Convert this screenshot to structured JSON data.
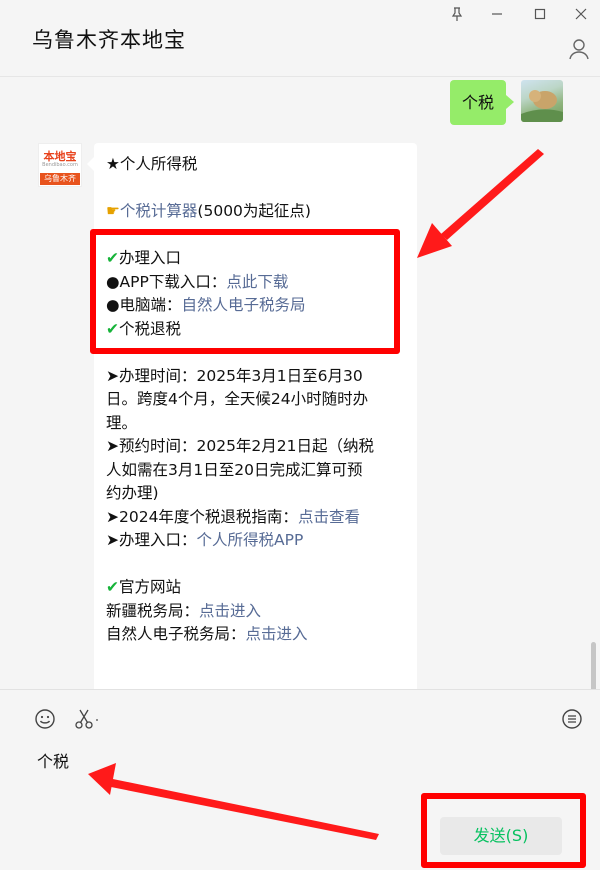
{
  "window": {
    "title": "乌鲁木齐本地宝",
    "pin_icon": "pin-icon",
    "minimize_icon": "minimize-icon",
    "maximize_icon": "maximize-icon",
    "close_icon": "close-icon",
    "profile_icon": "profile-icon"
  },
  "chat": {
    "user_message": "个税",
    "bot_avatar": {
      "top": "本地宝",
      "mid": "Bendibao.com",
      "bar": "乌鲁木齐"
    },
    "bot_message": {
      "heading": "★个人所得税",
      "calc_link": "个税计算器",
      "calc_note": "(5000为起征点)",
      "section1_title": "办理入口",
      "app_label": "●APP下载入口：",
      "app_link": "点此下载",
      "pc_label": "●电脑端：",
      "pc_link": "自然人电子税务局",
      "section2_title": "个税退税",
      "time_line1": "➤办理时间：2025年3月1日至6月30",
      "time_line2": "日。跨度4个月，全天候24小时随时办",
      "time_line3": "理。",
      "appt_line1": "➤预约时间：2025年2月21日起（纳税",
      "appt_line2": "人如需在3月1日至20日完成汇算可预",
      "appt_line3": "约办理)",
      "guide_label": "➤2024年度个税退税指南：",
      "guide_link": "点击查看",
      "entry_label": "➤办理入口：",
      "entry_link": "个人所得税APP",
      "section3_title": "官方网站",
      "xj_label": "新疆税务局：",
      "xj_link": "点击进入",
      "zr_label": "自然人电子税务局：",
      "zr_link": "点击进入"
    }
  },
  "toolbar": {
    "emoji_icon": "emoji-icon",
    "scissors_icon": "scissors-icon",
    "chat_history_icon": "chat-history-icon"
  },
  "input": {
    "value": "个税"
  },
  "send_button": {
    "label": "发送(S)"
  },
  "colors": {
    "user_bubble": "#95ec69",
    "link": "#576b95",
    "send_text": "#07c160",
    "annotation": "#ff0000"
  }
}
